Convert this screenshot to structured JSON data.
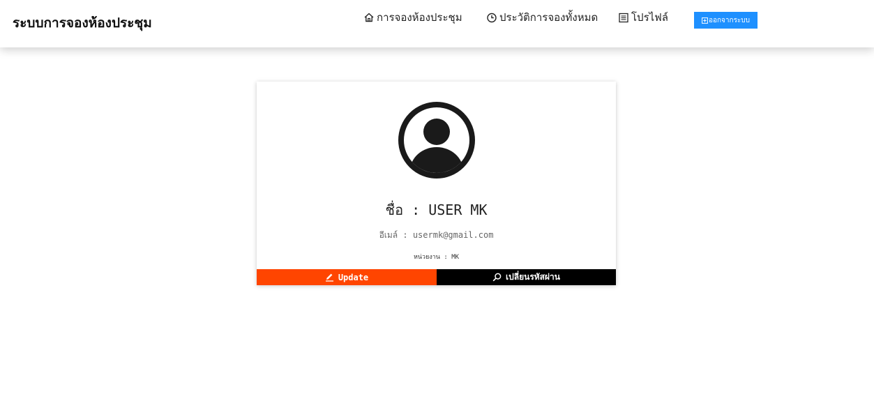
{
  "header": {
    "brand": "ระบบการจองห้องประชุม",
    "nav": {
      "home": "การจองห้องประชุม",
      "history": "ประวัติการจองทั้งหมด",
      "profile": "โปรไฟล์"
    },
    "logout_label": "ออกจากระบบ",
    "logout_color": "#1e90ff"
  },
  "profile": {
    "name_line": "ชื่อ : USER MK",
    "email_line": "อีเมล์ : usermk@gmail.com",
    "department_line": "หน่วยงาน : MK",
    "update_label": "Update",
    "change_password_label": "เปลี่ยนรหัสผ่าน",
    "update_color": "#ff4500",
    "change_password_color": "#000000"
  },
  "icons": {
    "home": "home-icon",
    "history": "clock-icon",
    "profile": "list-icon",
    "logout": "logout-icon",
    "avatar": "user-circle-icon",
    "update": "pencil-icon",
    "password": "search-key-icon"
  }
}
